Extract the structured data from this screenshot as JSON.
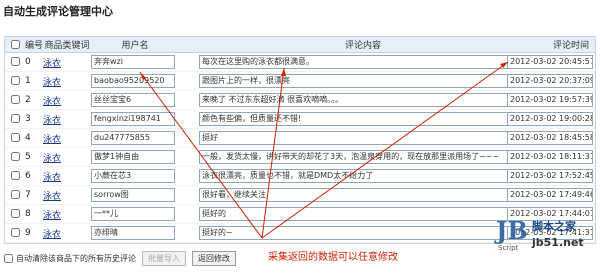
{
  "page_title": "自动生成评论管理中心",
  "table": {
    "headers": {
      "num": "编号",
      "category": "商品类键词",
      "user": "用户名",
      "comment": "评论内容",
      "time": "评论时间"
    },
    "rows": [
      {
        "num": "0",
        "category": "泳衣",
        "user": "奔奔wzi",
        "comment": "每次在这里购的泳衣都很满意。",
        "time": "2012-03-02 20:45:57"
      },
      {
        "num": "1",
        "category": "泳衣",
        "user": "baobao95209520",
        "comment": "跟图片上的一样，很漂亮",
        "time": "2012-03-02 20:37:09"
      },
      {
        "num": "2",
        "category": "泳衣",
        "user": "丝丝宝宝6",
        "comment": "来晚了 不过东东超好滴 很喜欢嘀嘀。。。",
        "time": "2012-03-02 19:57:39"
      },
      {
        "num": "3",
        "category": "泳衣",
        "user": "fengxinzi198741",
        "comment": "颜色有些偏，但质量还不错!",
        "time": "2012-03-02 19:00:28"
      },
      {
        "num": "4",
        "category": "泳衣",
        "user": "du247775855",
        "comment": "挺好",
        "time": "2012-03-02 18:45:58"
      },
      {
        "num": "5",
        "category": "泳衣",
        "user": "傲梦1钟自由",
        "comment": "一般，发货太慢，讲好带天的却花了3天，泡温泉穿用的，现在放那里派用场了~~~",
        "time": "2012-03-02 18:11:31"
      },
      {
        "num": "6",
        "category": "泳衣",
        "user": "小蕨在芯3",
        "comment": "泳衣很漂亮，质量也不错，就是DMD太不给力了",
        "time": "2012-03-02 17:52:45"
      },
      {
        "num": "7",
        "category": "泳衣",
        "user": "sorrow图",
        "comment": "很好看，继续关注",
        "time": "2012-03-02 17:49:46"
      },
      {
        "num": "8",
        "category": "泳衣",
        "user": "一**儿",
        "comment": "挺好的",
        "time": "2012-03-02 17:44:01"
      },
      {
        "num": "9",
        "category": "泳衣",
        "user": "亦绯晴",
        "comment": "挺好的~",
        "time": "2012-03-02 17:41:37"
      }
    ]
  },
  "footer": {
    "checkbox_label": "自动清除该商品下的所有历史评论",
    "import_button": "批量导入",
    "back_button": "返回修改"
  },
  "annotation": "采集返回的数据可以任意修改",
  "watermark": {
    "logo_letter": "JB",
    "script": "Script",
    "site_name": "脚本之家",
    "url": "jb51.net"
  },
  "colors": {
    "header_bg": "#e6eef8",
    "border": "#c8d4e0",
    "link": "#1a3a8a",
    "annotation": "#cc2200"
  }
}
